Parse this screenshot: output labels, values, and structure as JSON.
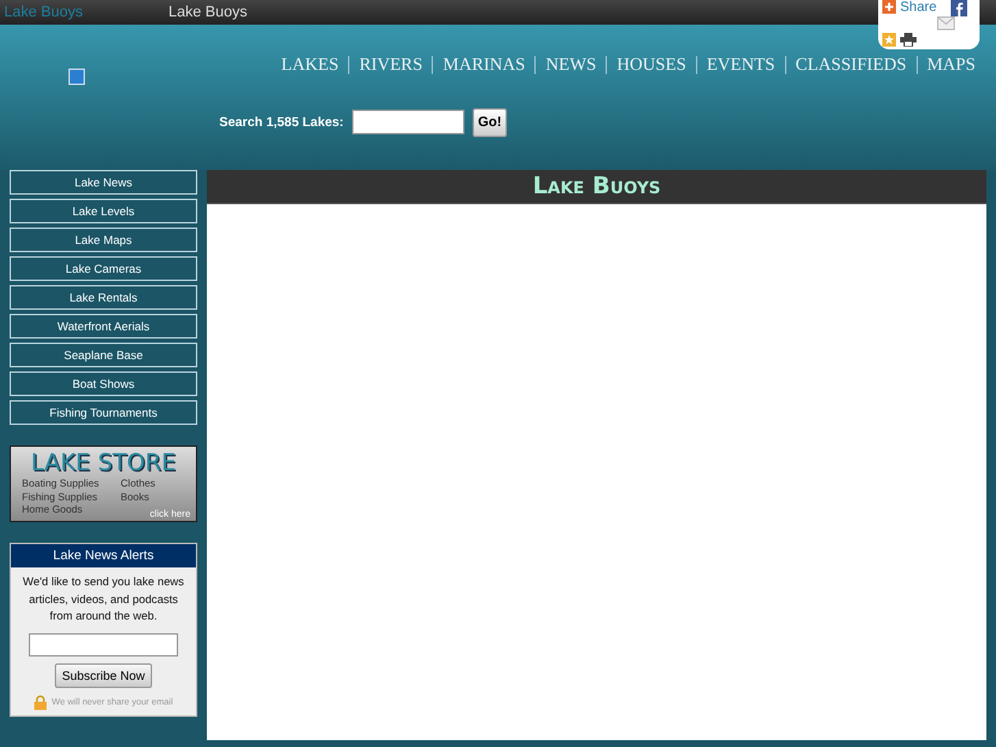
{
  "top_bar": {
    "logo_text": "Lake Buoys",
    "title": "Lake Buoys"
  },
  "share_widget": {
    "share_label": "Share"
  },
  "nav": [
    "LAKES",
    "RIVERS",
    "MARINAS",
    "NEWS",
    "HOUSES",
    "EVENTS",
    "CLASSIFIEDS",
    "MAPS"
  ],
  "search": {
    "label": "Search 1,585 Lakes:",
    "button": "Go!"
  },
  "sidebar": {
    "items": [
      "Lake News",
      "Lake Levels",
      "Lake Maps",
      "Lake Cameras",
      "Lake Rentals",
      "Waterfront Aerials",
      "Seaplane Base",
      "Boat Shows",
      "Fishing Tournaments"
    ],
    "store_banner": {
      "title": "LAKE STORE",
      "items": [
        "Boating Supplies",
        "Clothes",
        "Fishing Supplies",
        "Books",
        "Home Goods"
      ],
      "cta": "click here"
    },
    "alerts": {
      "title": "Lake News Alerts",
      "text": "We'd like to send you lake news articles, videos, and podcasts from around the web.",
      "button": "Subscribe Now",
      "privacy": "We will never share your email"
    }
  },
  "main": {
    "title": "Lake Buoys"
  }
}
